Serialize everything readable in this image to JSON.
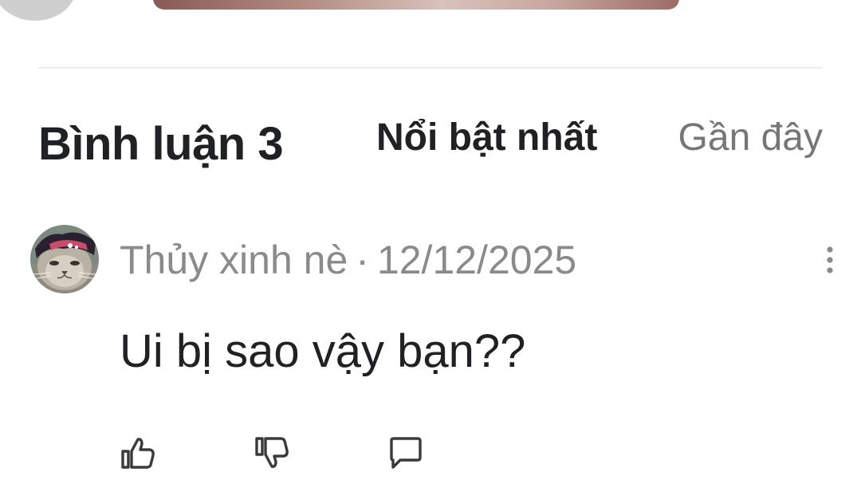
{
  "header": {
    "title": "Bình luận 3"
  },
  "sort": {
    "top_label": "Nổi bật nhất",
    "recent_label": "Gần đây"
  },
  "comments": [
    {
      "author": "Thủy xinh nè",
      "separator": "·",
      "date": "12/12/2025",
      "text": "Ui bị sao vậy bạn??"
    }
  ],
  "icons": {
    "more": "more-vertical-icon",
    "like": "thumbs-up-icon",
    "dislike": "thumbs-down-icon",
    "reply": "comment-icon"
  },
  "colors": {
    "primary_text": "#202124",
    "secondary_text": "#8a8a8a",
    "inactive_tab": "#767676",
    "divider": "#ececec"
  }
}
